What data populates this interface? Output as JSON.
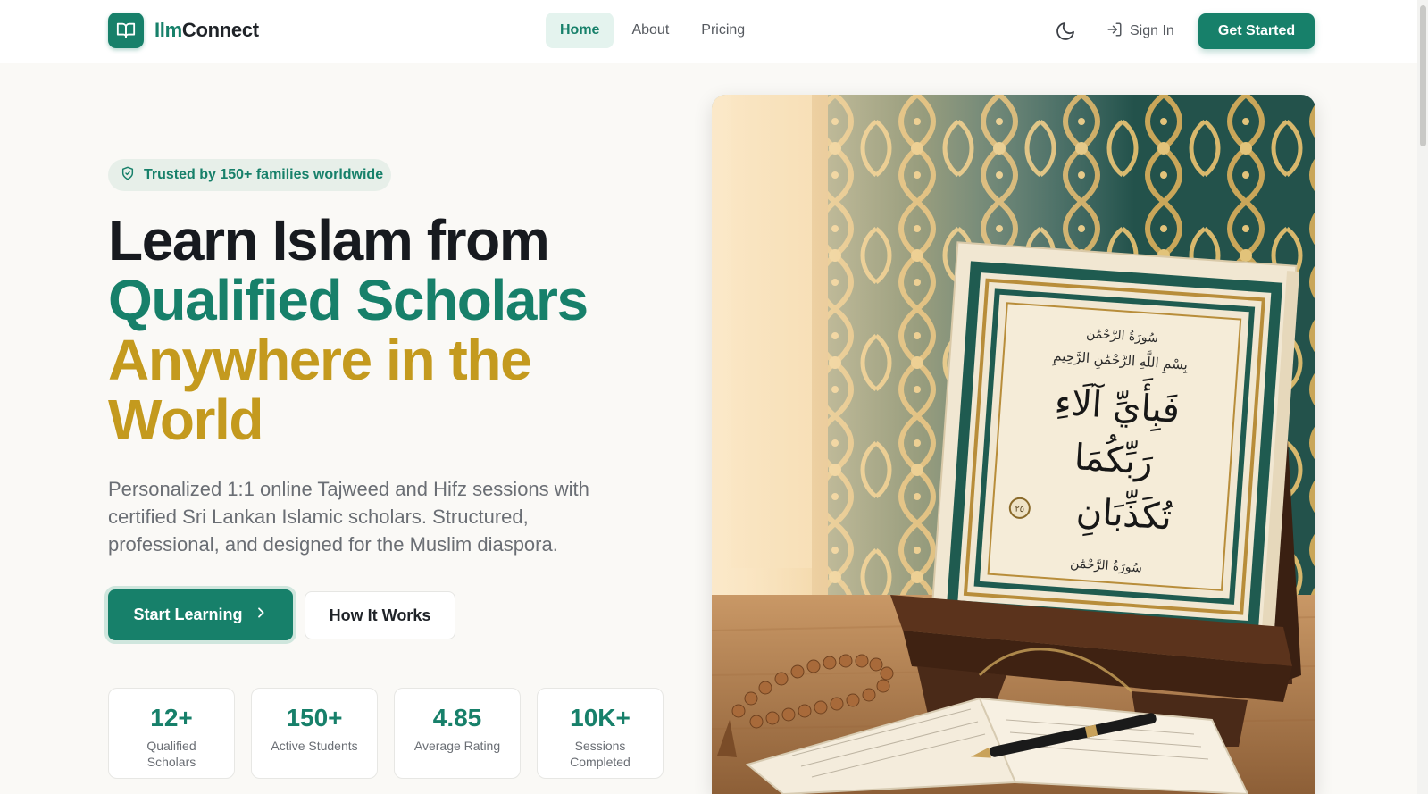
{
  "brand": {
    "name_part1": "Ilm",
    "name_part2": "Connect",
    "icon": "open-book-icon"
  },
  "nav": {
    "items": [
      {
        "label": "Home",
        "active": true
      },
      {
        "label": "About",
        "active": false
      },
      {
        "label": "Pricing",
        "active": false
      }
    ]
  },
  "header_actions": {
    "theme_icon": "moon-icon",
    "sign_in_label": "Sign In",
    "sign_in_icon": "log-in-icon",
    "get_started_label": "Get Started"
  },
  "hero": {
    "badge": "Trusted by 150+ families worldwide",
    "badge_icon": "shield-check-icon",
    "headline_line1": "Learn Islam from",
    "headline_line2": "Qualified Scholars",
    "headline_line3": "Anywhere in the World",
    "subtitle": "Personalized 1:1 online Tajweed and Hifz sessions with certified Sri Lankan Islamic scholars. Structured, professional, and designed for the Muslim diaspora.",
    "primary_cta": "Start Learning",
    "primary_cta_icon": "chevron-right-icon",
    "secondary_cta": "How It Works"
  },
  "stats": [
    {
      "value": "12+",
      "label": "Qualified Scholars"
    },
    {
      "value": "150+",
      "label": "Active Students"
    },
    {
      "value": "4.85",
      "label": "Average Rating"
    },
    {
      "value": "10K+",
      "label": "Sessions Completed"
    }
  ],
  "hero_image": {
    "arabic_header": "سُورَةُ الرَّحْمَٰن",
    "arabic_bismillah": "بِسْمِ اللَّهِ الرَّحْمَٰنِ الرَّحِيمِ",
    "arabic_line1": "فَبِأَيِّ آلَاءِ",
    "arabic_line2": "رَبِّكُمَا",
    "arabic_line3": "تُكَذِّبَانِ",
    "verse_number": "٢٥",
    "arabic_footer": "سُورَةُ الرَّحْمَٰن"
  },
  "colors": {
    "primary": "#17806a",
    "gold": "#c49a1e",
    "heading": "#171a1f",
    "muted": "#6a6e74",
    "background": "#faf9f6"
  }
}
